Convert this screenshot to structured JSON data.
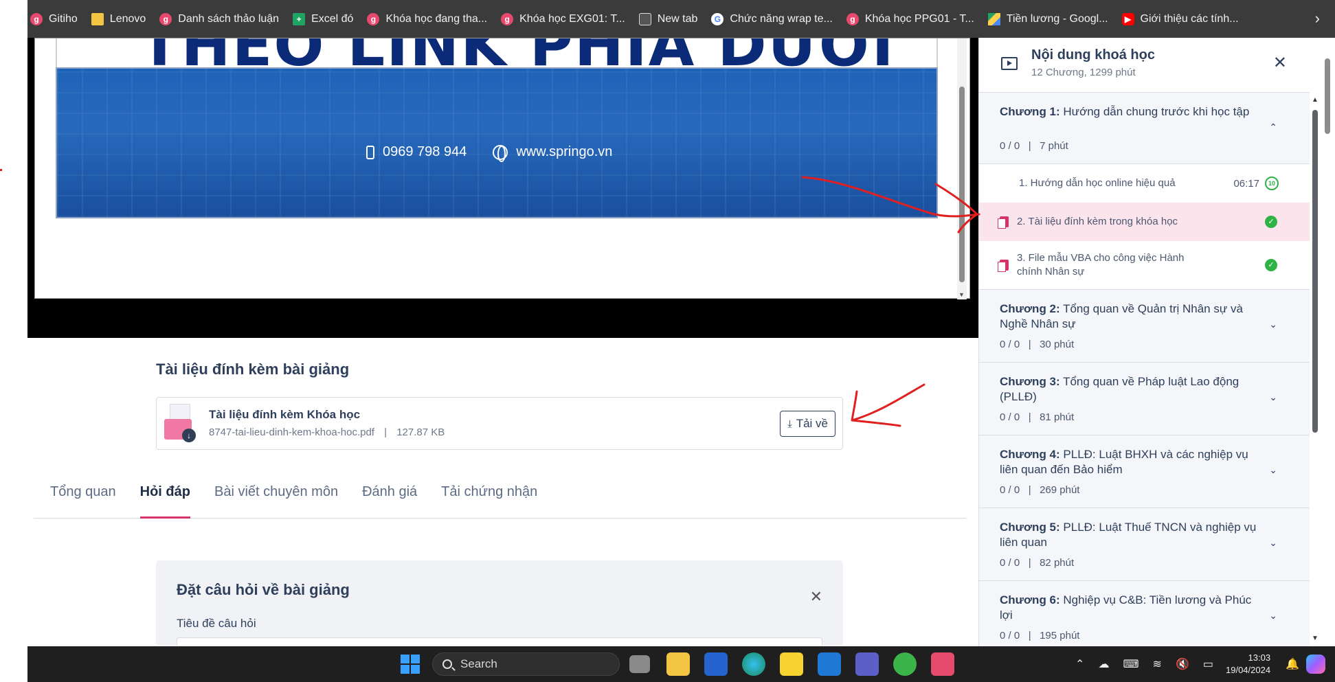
{
  "bookmarks": [
    {
      "label": "Gitiho",
      "icon": "gitiho-icon"
    },
    {
      "label": "Lenovo",
      "icon": "folder-icon"
    },
    {
      "label": "Danh sách thảo luận",
      "icon": "gitiho-icon"
    },
    {
      "label": "Excel đó",
      "icon": "sheets-icon"
    },
    {
      "label": "Khóa học đang tha...",
      "icon": "gitiho-icon"
    },
    {
      "label": "Khóa học EXG01: T...",
      "icon": "gitiho-icon"
    },
    {
      "label": "New tab",
      "icon": "newtab-icon"
    },
    {
      "label": "Chức năng wrap te...",
      "icon": "google-icon"
    },
    {
      "label": "Khóa học PPG01 - T...",
      "icon": "gitiho-icon"
    },
    {
      "label": "Tiền lương - Googl...",
      "icon": "drive-icon"
    },
    {
      "label": "Giới thiệu các tính...",
      "icon": "youtube-icon"
    }
  ],
  "slide": {
    "headline_partial": "THEO LINK PHÍA DƯỚI",
    "phone": "0969 798 944",
    "website": "www.springo.vn"
  },
  "attachments": {
    "title": "Tài liệu đính kèm bài giảng",
    "file_title": "Tài liệu đính kèm Khóa học",
    "file_name": "8747-tai-lieu-dinh-kem-khoa-hoc.pdf",
    "separator": "|",
    "file_size": "127.87 KB",
    "download_label": "Tải về"
  },
  "tabs": [
    {
      "label": "Tổng quan",
      "active": false
    },
    {
      "label": "Hỏi đáp",
      "active": true
    },
    {
      "label": "Bài viết chuyên môn",
      "active": false
    },
    {
      "label": "Đánh giá",
      "active": false
    },
    {
      "label": "Tải chứng nhận",
      "active": false
    }
  ],
  "question": {
    "title": "Đặt câu hỏi về bài giảng",
    "field_label": "Tiêu đề câu hỏi",
    "close": "✕"
  },
  "sidebar": {
    "title": "Nội dung khoá học",
    "subtitle": "12 Chương, 1299 phút",
    "close": "✕",
    "chapters": [
      {
        "prefix": "Chương 1:",
        "name": "Hướng dẫn chung trước khi học tập",
        "meta": "0 / 0   |   7 phút",
        "chev": "⌃",
        "expanded": true
      },
      {
        "prefix": "Chương 2:",
        "name": "Tổng quan về Quản trị Nhân sự và Nghề Nhân sự",
        "meta": "0 / 0   |   30 phút",
        "chev": "⌄"
      },
      {
        "prefix": "Chương 3:",
        "name": "Tổng quan về Pháp luật Lao động (PLLĐ)",
        "meta": "0 / 0   |   81 phút",
        "chev": "⌄"
      },
      {
        "prefix": "Chương 4:",
        "name": "PLLĐ: Luật BHXH và các nghiệp vụ liên quan đến Bảo hiểm",
        "meta": "0 / 0   |   269 phút",
        "chev": "⌄"
      },
      {
        "prefix": "Chương 5:",
        "name": "PLLĐ: Luật Thuế TNCN và nghiệp vụ liên quan",
        "meta": "0 / 0   |   82 phút",
        "chev": "⌄"
      },
      {
        "prefix": "Chương 6:",
        "name": "Nghiệp vụ C&B: Tiền lương và Phúc lợi",
        "meta": "0 / 0   |   195 phút",
        "chev": "⌄"
      }
    ],
    "lessons": [
      {
        "label": "1. Hướng dẫn học online hiệu quả",
        "duration": "06:17",
        "badge": "10",
        "type": "video"
      },
      {
        "label": "2. Tài liệu đính kèm trong khóa học",
        "type": "doc",
        "done": true,
        "active": true
      },
      {
        "label": "3. File mẫu VBA cho công việc Hành chính Nhân sự",
        "type": "doc",
        "done": true
      }
    ]
  },
  "taskbar": {
    "search_label": "Search",
    "time": "13:03",
    "date": "19/04/2024"
  },
  "colors": {
    "accent": "#d6336c",
    "navy": "#2e3f5c",
    "success": "#2fb344",
    "annotation": "#e02020"
  }
}
